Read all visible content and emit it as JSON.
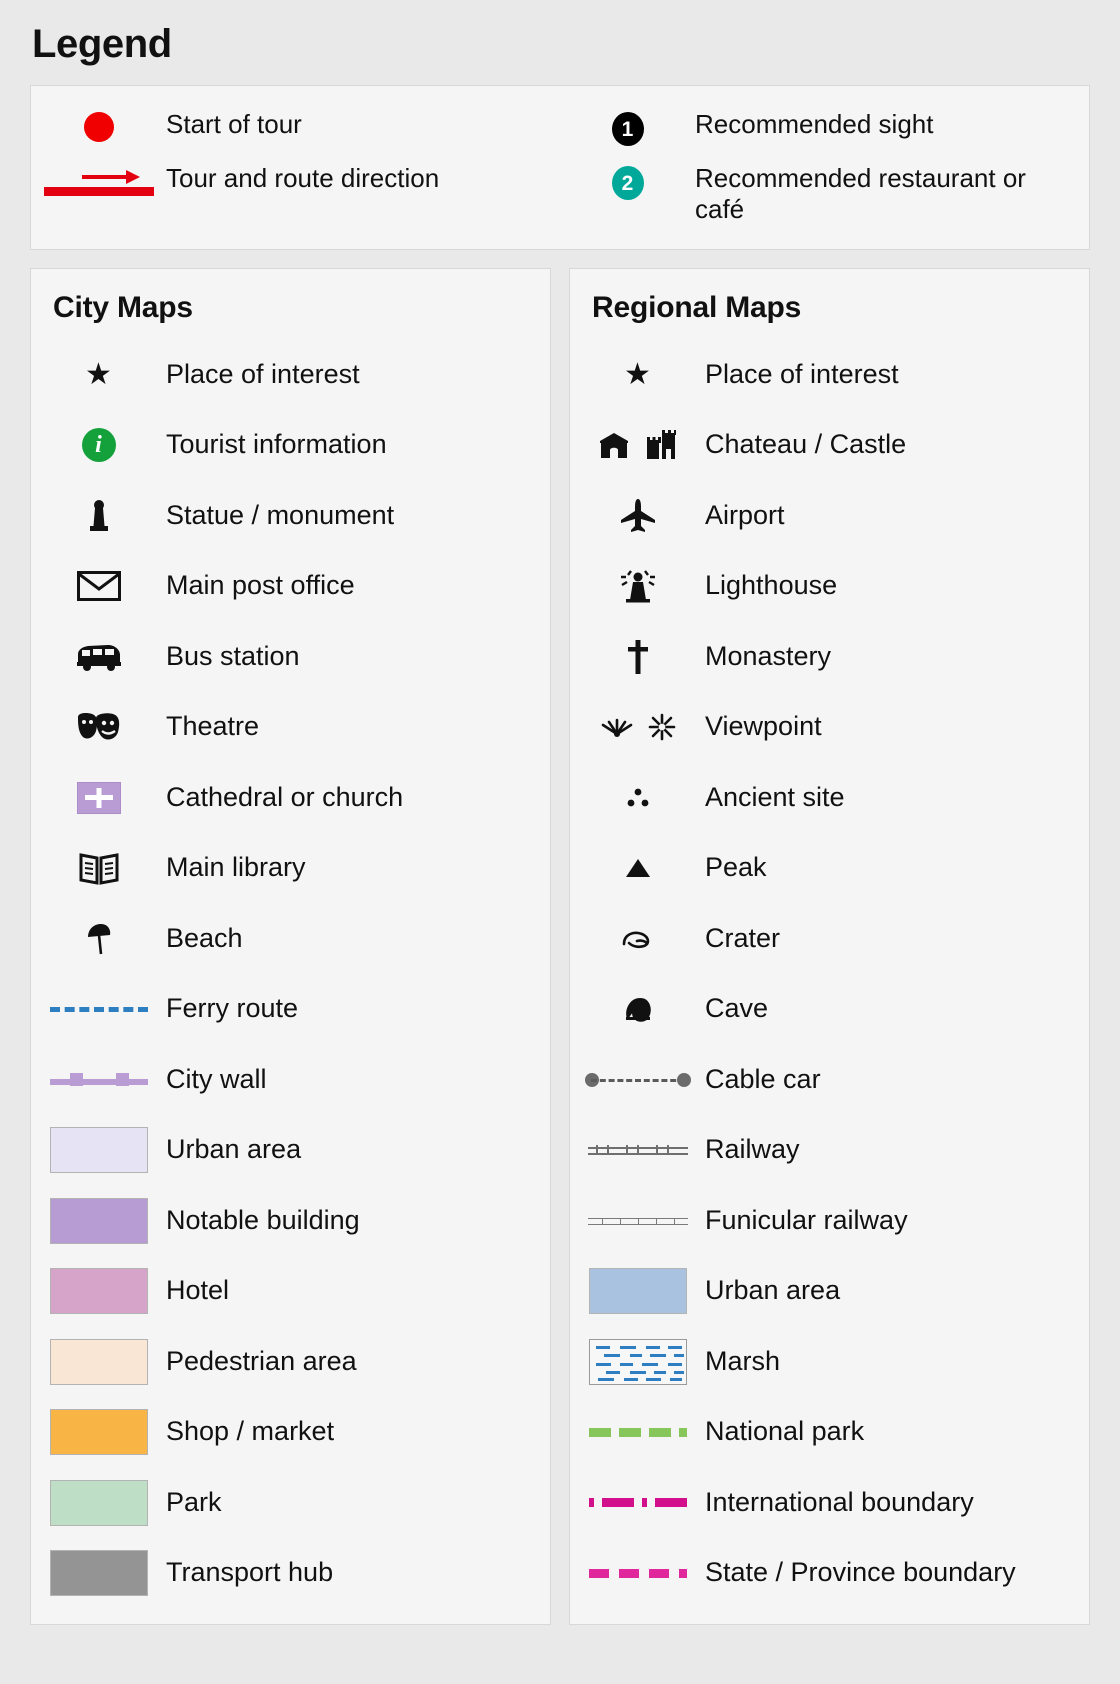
{
  "title": "Legend",
  "colors": {
    "tour_red": "#f00000",
    "route_red": "#e30011",
    "marker_sight": "#000000",
    "marker_restaurant": "#00a899",
    "tourist_info_green": "#14a13c",
    "church_purple": "#b99cd4",
    "ferry_blue": "#2d7fc1",
    "urban_area_city": "#e6e3f4",
    "notable_building": "#b79bd3",
    "hotel": "#d6a4c8",
    "pedestrian_area": "#fae6d5",
    "shop_market": "#f8b545",
    "park": "#bfdec6",
    "transport_hub": "#949494",
    "urban_area_regional": "#a8c2e0",
    "marsh_blue": "#2d7fc1",
    "national_park_green": "#86c65a",
    "international_boundary": "#d2108c",
    "state_boundary": "#e0279b",
    "cable_car_gray": "#6b6b6b",
    "railway_gray": "#6f6f6f",
    "panel_bg": "#f5f5f5",
    "page_bg": "#e9e9e9"
  },
  "general": {
    "left": [
      {
        "icon": "red-dot-icon",
        "label": "Start of tour"
      },
      {
        "icon": "route-direction-arrow-icon",
        "label": "Tour and route direction"
      }
    ],
    "right": [
      {
        "icon": "numbered-marker-black-icon",
        "marker": "1",
        "label": "Recommended sight"
      },
      {
        "icon": "numbered-marker-teal-icon",
        "marker": "2",
        "label": "Recommended restaurant or café"
      }
    ]
  },
  "city_maps": {
    "title": "City Maps",
    "items": [
      {
        "icon": "star-icon",
        "label": "Place of interest"
      },
      {
        "icon": "tourist-information-icon",
        "label": "Tourist information"
      },
      {
        "icon": "statue-monument-icon",
        "label": "Statue / monument"
      },
      {
        "icon": "envelope-post-office-icon",
        "label": "Main post office"
      },
      {
        "icon": "bus-icon",
        "label": "Bus station"
      },
      {
        "icon": "theatre-masks-icon",
        "label": "Theatre"
      },
      {
        "icon": "church-cross-swatch-icon",
        "label": "Cathedral or church"
      },
      {
        "icon": "open-book-library-icon",
        "label": "Main library"
      },
      {
        "icon": "beach-umbrella-icon",
        "label": "Beach"
      },
      {
        "icon": "ferry-route-dashed-line-icon",
        "label": "Ferry route"
      },
      {
        "icon": "city-wall-line-icon",
        "label": "City wall"
      },
      {
        "icon": "urban-area-swatch-icon",
        "label": "Urban area"
      },
      {
        "icon": "notable-building-swatch-icon",
        "label": "Notable building"
      },
      {
        "icon": "hotel-swatch-icon",
        "label": "Hotel"
      },
      {
        "icon": "pedestrian-area-swatch-icon",
        "label": "Pedestrian area"
      },
      {
        "icon": "shop-market-swatch-icon",
        "label": "Shop / market"
      },
      {
        "icon": "park-swatch-icon",
        "label": "Park"
      },
      {
        "icon": "transport-hub-swatch-icon",
        "label": "Transport hub"
      }
    ]
  },
  "regional_maps": {
    "title": "Regional Maps",
    "items": [
      {
        "icon": "star-icon",
        "label": "Place of interest"
      },
      {
        "icon": "chateau-castle-icon",
        "label": "Chateau / Castle"
      },
      {
        "icon": "airplane-icon",
        "label": "Airport"
      },
      {
        "icon": "lighthouse-icon",
        "label": "Lighthouse"
      },
      {
        "icon": "cross-monastery-icon",
        "label": "Monastery"
      },
      {
        "icon": "viewpoint-starburst-icon",
        "label": "Viewpoint"
      },
      {
        "icon": "ancient-site-dots-icon",
        "label": "Ancient site"
      },
      {
        "icon": "peak-triangle-icon",
        "label": "Peak"
      },
      {
        "icon": "crater-icon",
        "label": "Crater"
      },
      {
        "icon": "cave-icon",
        "label": "Cave"
      },
      {
        "icon": "cable-car-line-icon",
        "label": "Cable car"
      },
      {
        "icon": "railway-line-icon",
        "label": "Railway"
      },
      {
        "icon": "funicular-railway-line-icon",
        "label": "Funicular railway"
      },
      {
        "icon": "urban-area-swatch-icon",
        "label": "Urban area"
      },
      {
        "icon": "marsh-swatch-icon",
        "label": "Marsh"
      },
      {
        "icon": "national-park-dashed-line-icon",
        "label": "National park"
      },
      {
        "icon": "international-boundary-line-icon",
        "label": "International boundary"
      },
      {
        "icon": "state-province-boundary-line-icon",
        "label": "State / Province boundary"
      }
    ]
  }
}
